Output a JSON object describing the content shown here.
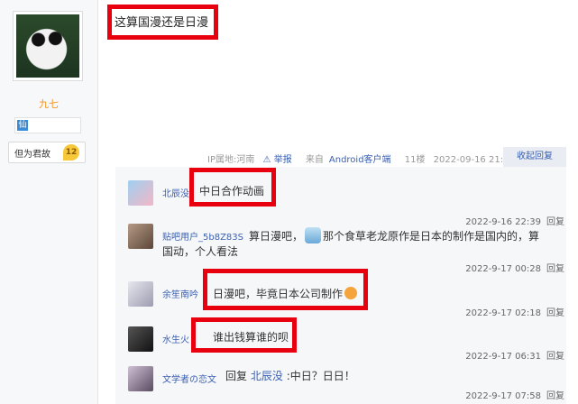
{
  "author": {
    "name": "九七",
    "badge_icon": "仙",
    "level_name": "但为君故",
    "level": "12"
  },
  "post": {
    "text": "这算国漫还是日漫",
    "meta": {
      "ip": "IP属地:河南",
      "report": "举报",
      "client_prefix": "来自",
      "client": "Android客户端",
      "floor": "11楼",
      "time": "2022-09-16 21:12"
    },
    "collapse_label": "收起回复"
  },
  "replies": [
    {
      "user": "北辰没",
      "text": "中日合作动画",
      "time": "2022-9-16 22:39",
      "reply": "回复"
    },
    {
      "user": "贴吧用户_5b8Z83S",
      "text_a": "算日漫吧，",
      "text_b": "那个食草老龙原作是日本的制作是国内的，算",
      "text_c": "国动，个人看法",
      "time": "2022-9-17 00:28",
      "reply": "回复"
    },
    {
      "user": "余笙南吟",
      "text": "日漫吧，毕竟日本公司制作",
      "time": "2022-9-17 02:18",
      "reply": "回复"
    },
    {
      "user": "水生火",
      "text": "谁出钱算谁的呗",
      "time": "2022-9-17 06:31",
      "reply": "回复"
    },
    {
      "user": "文学者の恋文",
      "text_reply": "回复",
      "mention": "北辰没",
      "text": ":中日？日日！",
      "time": "2022-9-17 07:58",
      "reply": "回复"
    }
  ],
  "colors": {
    "highlight_box": "#e8000f",
    "link": "#3a5fb0",
    "author_name": "#f7931e"
  }
}
